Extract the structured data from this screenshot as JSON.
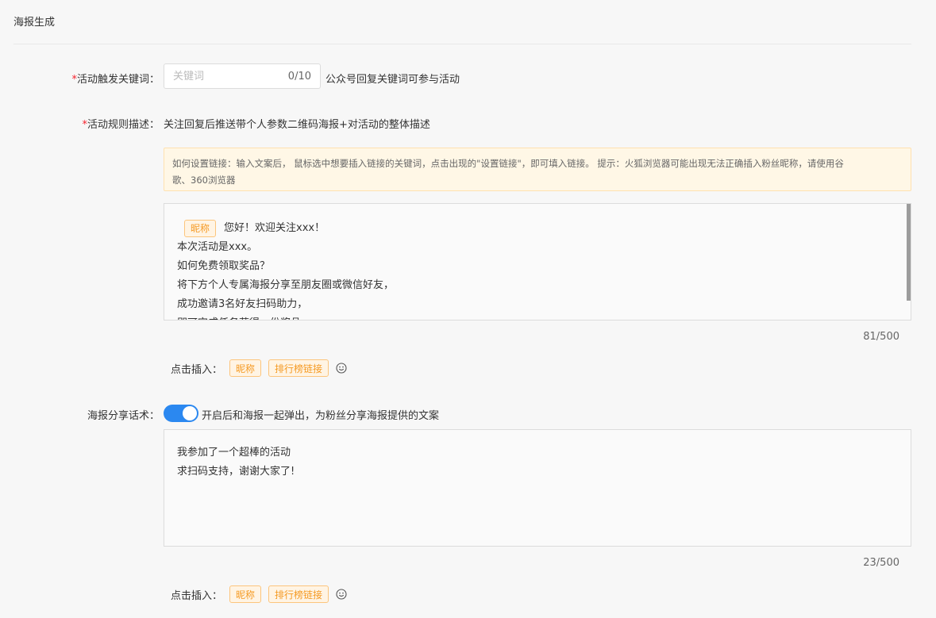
{
  "page": {
    "title": "海报生成"
  },
  "keyword": {
    "required_mark": "*",
    "label": "活动触发关键词：",
    "placeholder": "关键词",
    "count": "0/10",
    "hint": "公众号回复关键词可参与活动"
  },
  "rule": {
    "required_mark": "*",
    "label": "活动规则描述：",
    "text": "关注回复后推送带个人参数二维码海报+对活动的整体描述",
    "tip_line1": "如何设置链接：输入文案后， 鼠标选中想要插入链接的关键词，点击出现的\"设置链接\"，即可填入链接。 提示：火狐浏览器可能出现无法正确插入粉丝昵称，请使用谷",
    "tip_line2": "歌、360浏览器",
    "editor": {
      "nickname_chip": "昵称",
      "first_line": "您好！欢迎关注xxx！",
      "lines": [
        "本次活动是xxx。",
        "如何免费领取奖品？",
        "将下方个人专属海报分享至朋友圈或微信好友，",
        "成功邀请3名好友扫码助力，",
        "即可完成任务获得一份奖品"
      ]
    },
    "counter": "81/500",
    "insert_label": "点击插入：",
    "insert_tags": [
      "昵称",
      "排行榜链接"
    ]
  },
  "share": {
    "label": "海报分享话术：",
    "toggle_on": true,
    "toggle_hint": "开启后和海报一起弹出，为粉丝分享海报提供的文案",
    "lines": [
      "我参加了一个超棒的活动",
      "求扫码支持，谢谢大家了!"
    ],
    "counter": "23/500",
    "insert_label": "点击插入：",
    "insert_tags": [
      "昵称",
      "排行榜链接"
    ]
  },
  "colors": {
    "accent": "#2b88f0",
    "tag_text": "#f59a23",
    "tag_bg": "#fff4e4",
    "required": "#f5222d"
  },
  "icons": {
    "insert_emoji": "smile-icon"
  }
}
